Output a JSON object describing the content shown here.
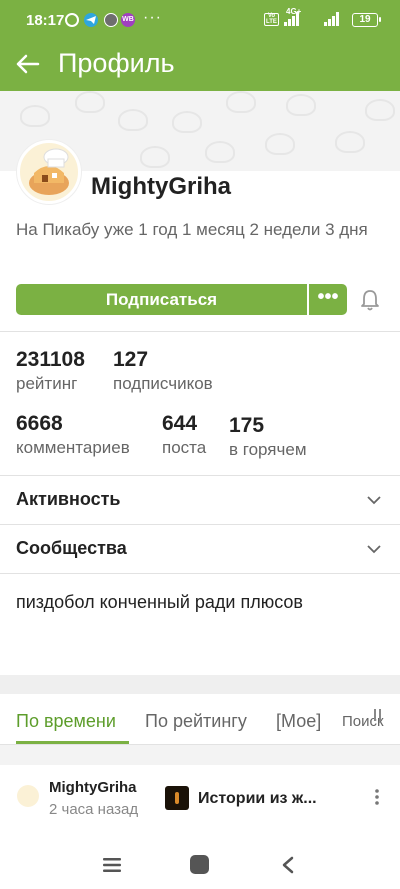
{
  "status_bar": {
    "time": "18:17",
    "network": "4G+",
    "volte": "Vo LTE",
    "battery": "19",
    "wb_icon": "WB"
  },
  "app_bar": {
    "title": "Профиль",
    "back_icon": "arrow-left-icon"
  },
  "profile": {
    "username": "MightyGriha",
    "since": "На Пикабу уже 1 год 1 месяц 2 недели 3 дня",
    "subscribe_label": "Подписаться",
    "more_label": "•••"
  },
  "stats": {
    "rating_value": "231108",
    "rating_label": "рейтинг",
    "subscribers_value": "127",
    "subscribers_label": "подписчиков",
    "comments_value": "6668",
    "comments_label": "комментариев",
    "posts_value": "644",
    "posts_label": "поста",
    "hot_value": "175",
    "hot_label": "в горячем"
  },
  "sections": {
    "activity": "Активность",
    "communities": "Сообщества"
  },
  "bio": "пиздобол конченный ради плюсов",
  "tabs": {
    "by_time": "По времени",
    "by_rating": "По рейтингу",
    "mine": "[Мое]",
    "search": "Поиск"
  },
  "post": {
    "author": "MightyGriha",
    "time": "2 часа назад",
    "community": "Истории из ж..."
  },
  "colors": {
    "accent": "#7bb143",
    "active_tab": "#5d9d2b"
  }
}
